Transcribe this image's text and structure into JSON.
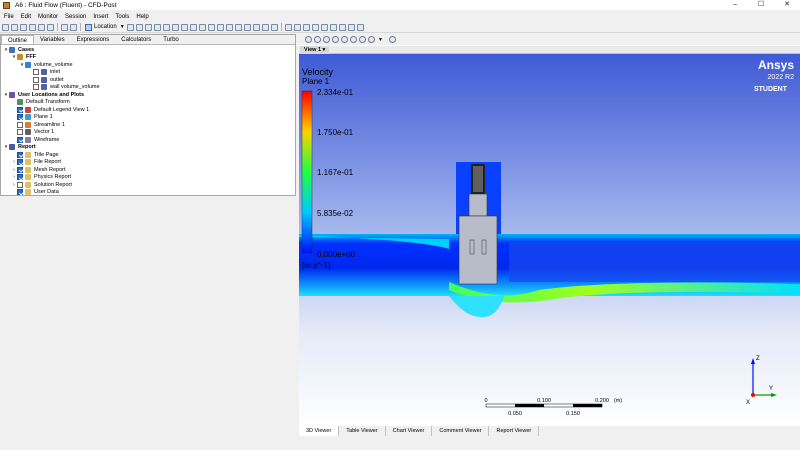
{
  "window": {
    "title": "A6 : Fluid Flow (Fluent) - CFD-Post",
    "controls": [
      "–",
      "☐",
      "✕"
    ]
  },
  "menu": [
    "File",
    "Edit",
    "Monitor",
    "Session",
    "Insert",
    "Tools",
    "Help"
  ],
  "toolbar": {
    "location_label": "Location"
  },
  "left_tabs": [
    {
      "label": "Outline",
      "active": true
    },
    {
      "label": "Variables",
      "active": false
    },
    {
      "label": "Expressions",
      "active": false
    },
    {
      "label": "Calculators",
      "active": false
    },
    {
      "label": "Turbo",
      "active": false
    }
  ],
  "tree": [
    {
      "level": 0,
      "expander": "▾",
      "check": null,
      "icon": "cases-icon",
      "label": "Cases",
      "bold": true
    },
    {
      "level": 1,
      "expander": "▾",
      "check": null,
      "icon": "case-file-icon",
      "label": "FFF",
      "bold": true
    },
    {
      "level": 2,
      "expander": "▾",
      "check": null,
      "icon": "volume-icon",
      "label": "volume_volume",
      "bold": false
    },
    {
      "level": 3,
      "expander": "",
      "check": false,
      "icon": "boundary-icon",
      "label": "inlet",
      "bold": false
    },
    {
      "level": 3,
      "expander": "",
      "check": false,
      "icon": "boundary-icon",
      "label": "outlet",
      "bold": false
    },
    {
      "level": 3,
      "expander": "",
      "check": false,
      "icon": "boundary-icon",
      "label": "wall volume_volume",
      "bold": false
    },
    {
      "level": 0,
      "expander": "▾",
      "check": null,
      "icon": "user-locations-icon",
      "label": "User Locations and Plots",
      "bold": true
    },
    {
      "level": 1,
      "expander": "",
      "check": null,
      "icon": "transform-icon",
      "label": "Default Transform",
      "bold": false
    },
    {
      "level": 1,
      "expander": "",
      "check": true,
      "icon": "legend-icon",
      "label": "Default Legend View 1",
      "bold": false
    },
    {
      "level": 1,
      "expander": "",
      "check": true,
      "icon": "plane-icon",
      "label": "Plane 1",
      "bold": false
    },
    {
      "level": 1,
      "expander": "",
      "check": false,
      "icon": "streamline-icon",
      "label": "Streamline 1",
      "bold": false
    },
    {
      "level": 1,
      "expander": "",
      "check": false,
      "icon": "vector-icon",
      "label": "Vector 1",
      "bold": false
    },
    {
      "level": 1,
      "expander": "",
      "check": true,
      "icon": "wireframe-icon",
      "label": "Wireframe",
      "bold": false
    },
    {
      "level": 0,
      "expander": "▾",
      "check": null,
      "icon": "report-icon",
      "label": "Report",
      "bold": true
    },
    {
      "level": 1,
      "expander": "",
      "check": true,
      "icon": "page-icon",
      "label": "Title Page",
      "bold": false
    },
    {
      "level": 1,
      "expander": "›",
      "check": true,
      "icon": "page-icon",
      "label": "File Report",
      "bold": false
    },
    {
      "level": 1,
      "expander": "›",
      "check": true,
      "icon": "page-icon",
      "label": "Mesh Report",
      "bold": false
    },
    {
      "level": 1,
      "expander": "›",
      "check": true,
      "icon": "page-icon",
      "label": "Physics Report",
      "bold": false
    },
    {
      "level": 1,
      "expander": "›",
      "check": false,
      "icon": "page-icon",
      "label": "Solution Report",
      "bold": false
    },
    {
      "level": 1,
      "expander": "",
      "check": true,
      "icon": "page-icon",
      "label": "User Data",
      "bold": false
    }
  ],
  "view": {
    "tab_label": "View 1"
  },
  "legend": {
    "variable": "Velocity",
    "location": "Plane 1",
    "levels": [
      "2.334e-01",
      "1.750e-01",
      "1.167e-01",
      "5.835e-02",
      "0.000e+00"
    ],
    "units": "[m s^-1]"
  },
  "branding": {
    "name": "Ansys",
    "version": "2022 R2",
    "edition": "STUDENT"
  },
  "scale_bar": {
    "top_labels": [
      "0",
      "0.100",
      "0.200",
      "(m)"
    ],
    "bottom_labels": [
      "0.050",
      "0.150"
    ]
  },
  "axes": {
    "z": "Z",
    "y": "Y",
    "x": "X"
  },
  "colors": {
    "accent": "#2a6fd0",
    "background_top": "#4a64d8",
    "background_bottom": "#ffffff"
  },
  "bottom_tabs": [
    {
      "label": "3D Viewer",
      "active": true
    },
    {
      "label": "Table Viewer",
      "active": false
    },
    {
      "label": "Chart Viewer",
      "active": false
    },
    {
      "label": "Comment Viewer",
      "active": false
    },
    {
      "label": "Report Viewer",
      "active": false
    }
  ]
}
